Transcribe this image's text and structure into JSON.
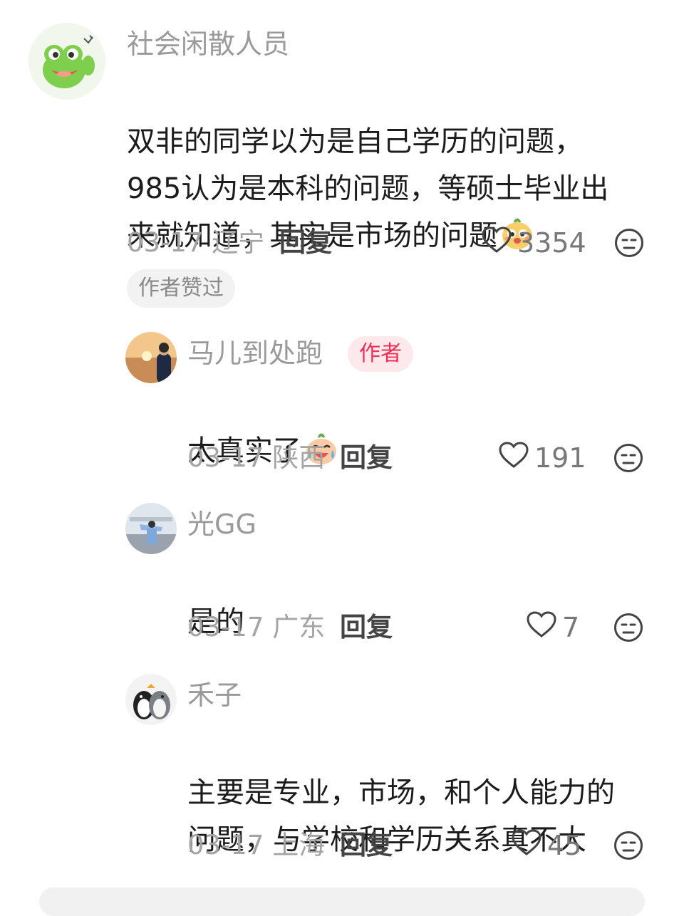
{
  "comments": [
    {
      "name": "社会闲散人员",
      "text": "双非的同学以为是自己学历的问题，\n985认为是本科的问题，等硕士毕业出\n来就知道，其实是市场的问题",
      "emoji": "sly-face-emoji",
      "meta": "03-17 辽宁",
      "reply": "回复",
      "likes": "3354",
      "badge": "作者赞过",
      "replies": [
        {
          "name": "马儿到处跑",
          "author_tag": "作者",
          "text": "太真实了",
          "emoji": "crying-laughing-emoji",
          "meta": "03-17 陕西",
          "reply": "回复",
          "likes": "191"
        },
        {
          "name": "光GG",
          "text": "是的",
          "meta": "03-17 广东",
          "reply": "回复",
          "likes": "7"
        },
        {
          "name": "禾子",
          "text": "主要是专业，市场，和个人能力的\n问题，与学校和学历关系真不大",
          "meta": "03-17 上海",
          "reply": "回复",
          "likes": "45"
        }
      ]
    }
  ],
  "icons": {
    "like": "heart-outline-icon",
    "dislike": "meh-face-icon"
  },
  "colors": {
    "author_tag_bg": "#fde8ec",
    "author_tag_text": "#ee2e58",
    "muted_text": "#9a9a9a",
    "body_text": "#1c1c1c"
  }
}
